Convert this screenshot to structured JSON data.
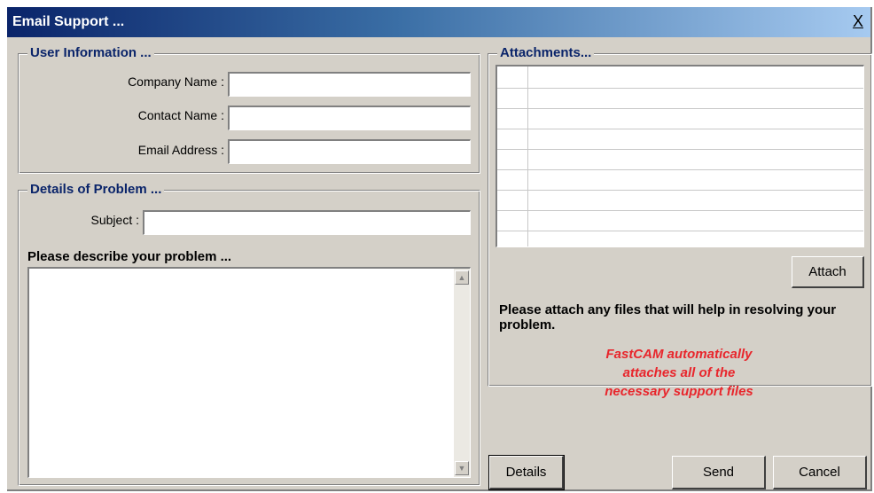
{
  "window": {
    "title": "Email Support ...",
    "close_glyph": "X"
  },
  "user_info": {
    "legend": "User Information ...",
    "company_label": "Company Name :",
    "company_value": "",
    "contact_label": "Contact Name :",
    "contact_value": "",
    "email_label": "Email Address :",
    "email_value": ""
  },
  "details": {
    "legend": "Details of Problem ...",
    "subject_label": "Subject :",
    "subject_value": "",
    "describe_label": "Please describe your problem ...",
    "describe_value": ""
  },
  "attachments": {
    "legend": "Attachments...",
    "attach_button": "Attach",
    "message": "Please attach any files that will help in resolving your problem.",
    "note_line1": "FastCAM automatically",
    "note_line2": "attaches all of the",
    "note_line3": "necessary support files"
  },
  "buttons": {
    "details": "Details",
    "send": "Send",
    "cancel": "Cancel"
  },
  "colors": {
    "legend": "#0a246a",
    "note": "#e8262c",
    "titlebar_start": "#0a246a"
  }
}
